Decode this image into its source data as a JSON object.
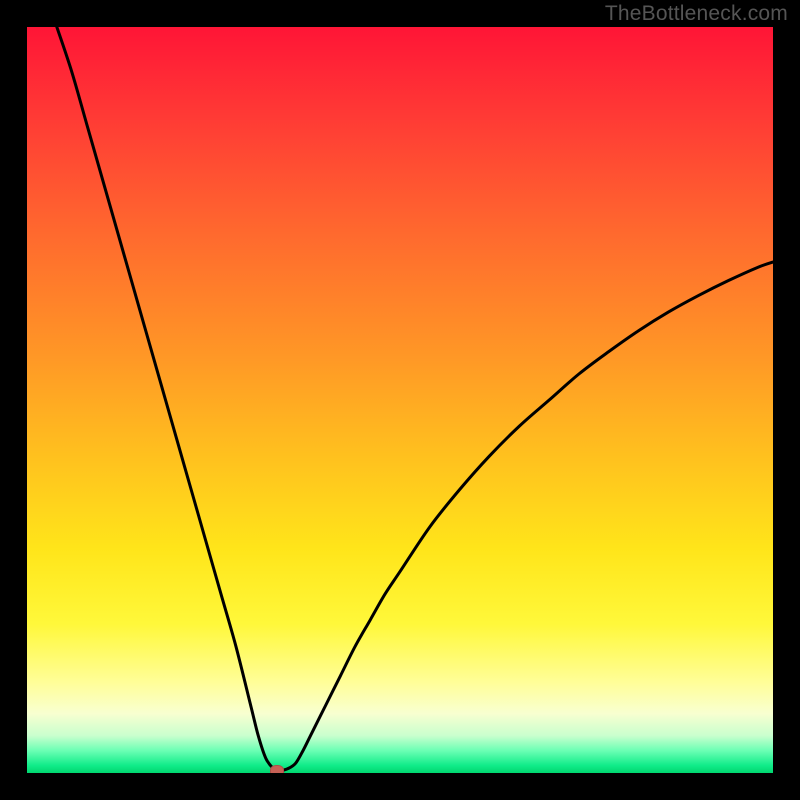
{
  "watermark": "TheBottleneck.com",
  "chart_data": {
    "type": "line",
    "title": "",
    "xlabel": "",
    "ylabel": "",
    "xlim": [
      0,
      100
    ],
    "ylim": [
      0,
      100
    ],
    "grid": false,
    "background": "red-yellow-green vertical gradient",
    "series": [
      {
        "name": "bottleneck-curve",
        "x": [
          4,
          6,
          8,
          10,
          12,
          14,
          16,
          18,
          20,
          22,
          24,
          26,
          28,
          30,
          31,
          32,
          33,
          33.5,
          34,
          35,
          36,
          37,
          38,
          40,
          42,
          44,
          46,
          48,
          50,
          54,
          58,
          62,
          66,
          70,
          74,
          78,
          82,
          86,
          90,
          94,
          98,
          100
        ],
        "y": [
          100,
          94,
          87,
          80,
          73,
          66,
          59,
          52,
          45,
          38,
          31,
          24,
          17,
          9,
          5,
          2,
          0.6,
          0.3,
          0.3,
          0.6,
          1.3,
          3,
          5,
          9,
          13,
          17,
          20.5,
          24,
          27,
          33,
          38,
          42.5,
          46.5,
          50,
          53.5,
          56.5,
          59.3,
          61.8,
          64,
          66,
          67.8,
          68.5
        ]
      }
    ],
    "marker": {
      "x": 33.5,
      "y": 0.3,
      "color": "#c66055"
    },
    "gradient_stops": [
      {
        "pos": 0,
        "color": "#ff1536"
      },
      {
        "pos": 12,
        "color": "#ff3a35"
      },
      {
        "pos": 28,
        "color": "#ff6a2e"
      },
      {
        "pos": 44,
        "color": "#ff9726"
      },
      {
        "pos": 58,
        "color": "#ffc21e"
      },
      {
        "pos": 70,
        "color": "#ffe51a"
      },
      {
        "pos": 80,
        "color": "#fff83a"
      },
      {
        "pos": 88,
        "color": "#fffe9a"
      },
      {
        "pos": 92,
        "color": "#f8ffd0"
      },
      {
        "pos": 95,
        "color": "#c9ffce"
      },
      {
        "pos": 97,
        "color": "#6bffb4"
      },
      {
        "pos": 99,
        "color": "#10ec89"
      },
      {
        "pos": 100,
        "color": "#00d66f"
      }
    ]
  }
}
